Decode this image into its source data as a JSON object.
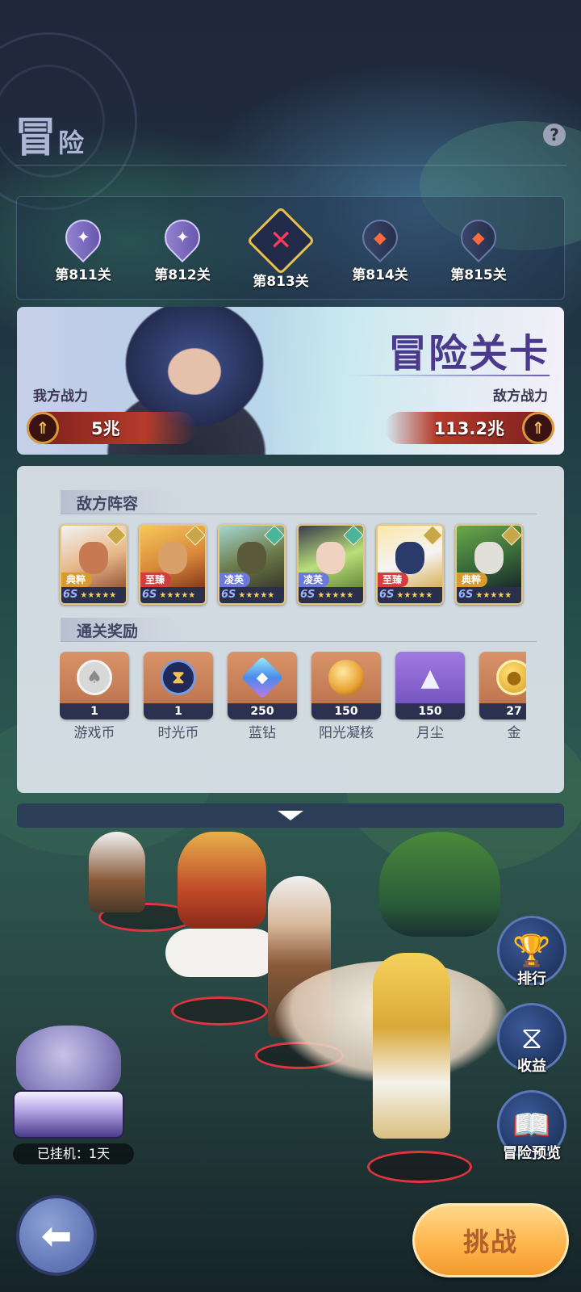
{
  "header": {
    "title_big": "冒",
    "title_small": "险",
    "help_icon": "question-icon"
  },
  "stages": [
    {
      "label": "第811关",
      "state": "cleared"
    },
    {
      "label": "第812关",
      "state": "cleared"
    },
    {
      "label": "第813关",
      "state": "current"
    },
    {
      "label": "第814关",
      "state": "locked"
    },
    {
      "label": "第815关",
      "state": "locked"
    }
  ],
  "banner": {
    "title": "冒险关卡",
    "my_power_label": "我方战力",
    "my_power_value": "5兆",
    "enemy_power_label": "敌方战力",
    "enemy_power_value": "113.2兆"
  },
  "enemy_lineup": {
    "heading": "敌方阵容",
    "heroes": [
      {
        "rank": "典粹",
        "rank_color": "#d99a2e",
        "stars": "★★★★★",
        "level_tag": "6S"
      },
      {
        "rank": "至臻",
        "rank_color": "#d63c3c",
        "stars": "★★★★★",
        "level_tag": "6S"
      },
      {
        "rank": "凌英",
        "rank_color": "#6a7ad6",
        "stars": "★★★★★",
        "level_tag": "6S"
      },
      {
        "rank": "凌英",
        "rank_color": "#6a7ad6",
        "stars": "★★★★★",
        "level_tag": "6S"
      },
      {
        "rank": "至臻",
        "rank_color": "#d63c3c",
        "stars": "★★★★★",
        "level_tag": "6S"
      },
      {
        "rank": "典粹",
        "rank_color": "#d99a2e",
        "stars": "★★★★★",
        "level_tag": "6S"
      }
    ]
  },
  "rewards": {
    "heading": "通关奖励",
    "items": [
      {
        "name": "游戏币",
        "qty": "1",
        "icon": "spade-coin-icon"
      },
      {
        "name": "时光币",
        "qty": "1",
        "icon": "hourglass-coin-icon"
      },
      {
        "name": "蓝钻",
        "qty": "250",
        "icon": "diamond-icon"
      },
      {
        "name": "阳光凝核",
        "qty": "150",
        "icon": "sun-orb-icon"
      },
      {
        "name": "月尘",
        "qty": "150",
        "icon": "crystal-icon"
      },
      {
        "name": "金",
        "qty": "27",
        "icon": "gold-coin-icon"
      }
    ]
  },
  "side_buttons": [
    {
      "label": "排行",
      "icon": "trophy-icon"
    },
    {
      "label": "收益",
      "icon": "hourglass-icon"
    },
    {
      "label": "冒险预览",
      "icon": "book-icon"
    }
  ],
  "idle": {
    "label": "已挂机：1天"
  },
  "actions": {
    "challenge_label": "挑战",
    "back_icon": "back-arrow-icon"
  },
  "colors": {
    "accent_gold": "#f3a940",
    "panel_bg": "#dee5ec",
    "power_red": "#b53b2c",
    "title_purple": "#4b3a8c"
  }
}
